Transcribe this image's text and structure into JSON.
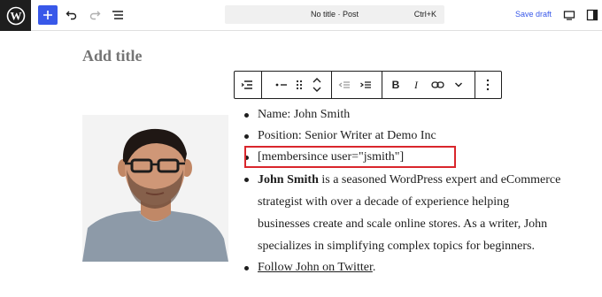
{
  "topbar": {
    "add_label": "+",
    "undo_icon": "undo-icon",
    "redo_icon": "redo-icon",
    "outline_icon": "document-overview-icon",
    "command": {
      "title": "No title · Post",
      "shortcut": "Ctrl+K"
    },
    "save_draft": "Save draft",
    "view_icon": "desktop-view-icon",
    "settings_icon": "settings-sidebar-icon",
    "accent_color": "#3858e9"
  },
  "editor": {
    "title_placeholder": "Add title",
    "block_toolbar": {
      "buttons": [
        "list-block-type",
        "unordered-list",
        "drag-handle",
        "move-up-down",
        "outdent",
        "indent",
        "bold",
        "italic",
        "link",
        "more-formatting",
        "options"
      ],
      "bold_label": "B",
      "italic_label": "I"
    },
    "image": {
      "subject": "author-photo"
    },
    "list": {
      "items": [
        "Name: John Smith",
        "Position: Senior Writer at Demo Inc",
        "[membersince user=\"jsmith\"]"
      ],
      "bio_name": "John Smith",
      "bio_text": " is a seasoned WordPress expert and eCommerce strategist with over a decade of experience helping businesses create and scale online stores. As a writer, John specializes in simplifying complex topics for beginners.",
      "link_text": "Follow John on Twitter",
      "link_suffix": "."
    },
    "highlight_color": "#d9262c"
  }
}
